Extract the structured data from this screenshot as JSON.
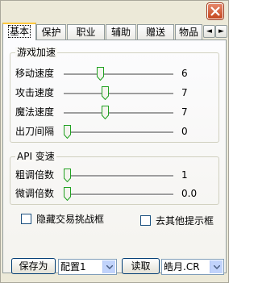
{
  "tabs": [
    {
      "label": "基本",
      "active": true
    },
    {
      "label": "保护",
      "active": false
    },
    {
      "label": "职业",
      "active": false
    },
    {
      "label": "辅助",
      "active": false
    },
    {
      "label": "赠送",
      "active": false
    },
    {
      "label": "物品",
      "active": false
    }
  ],
  "tab_scroll": {
    "left": "◄",
    "right": "►"
  },
  "speed_group": {
    "title": "游戏加速",
    "rows": [
      {
        "label": "移动速度",
        "value": "6",
        "level": 0.32
      },
      {
        "label": "攻击速度",
        "value": "7",
        "level": 0.37
      },
      {
        "label": "魔法速度",
        "value": "7",
        "level": 0.37
      },
      {
        "label": "出刀间隔",
        "value": "0",
        "level": 0.0
      }
    ]
  },
  "api_group": {
    "title": "API 变速",
    "rows": [
      {
        "label": "粗调倍数",
        "value": "1",
        "level": 0.0
      },
      {
        "label": "微调倍数",
        "value": "0.0",
        "level": 0.0
      }
    ]
  },
  "checkboxes": {
    "hide_trade": {
      "label": "隐藏交易挑战框",
      "checked": false
    },
    "remove_prompts": {
      "label": "去其他提示框",
      "checked": false
    }
  },
  "bottom": {
    "save_as_label": "保存为",
    "config_value": "配置1",
    "read_label": "读取",
    "file_value": "皓月.CR"
  },
  "colors": {
    "window_bg": "#ece9d8",
    "active_tab_highlight": "#ffc83c",
    "close_button": "#c4471f",
    "slider_thumb": "#21a121"
  }
}
